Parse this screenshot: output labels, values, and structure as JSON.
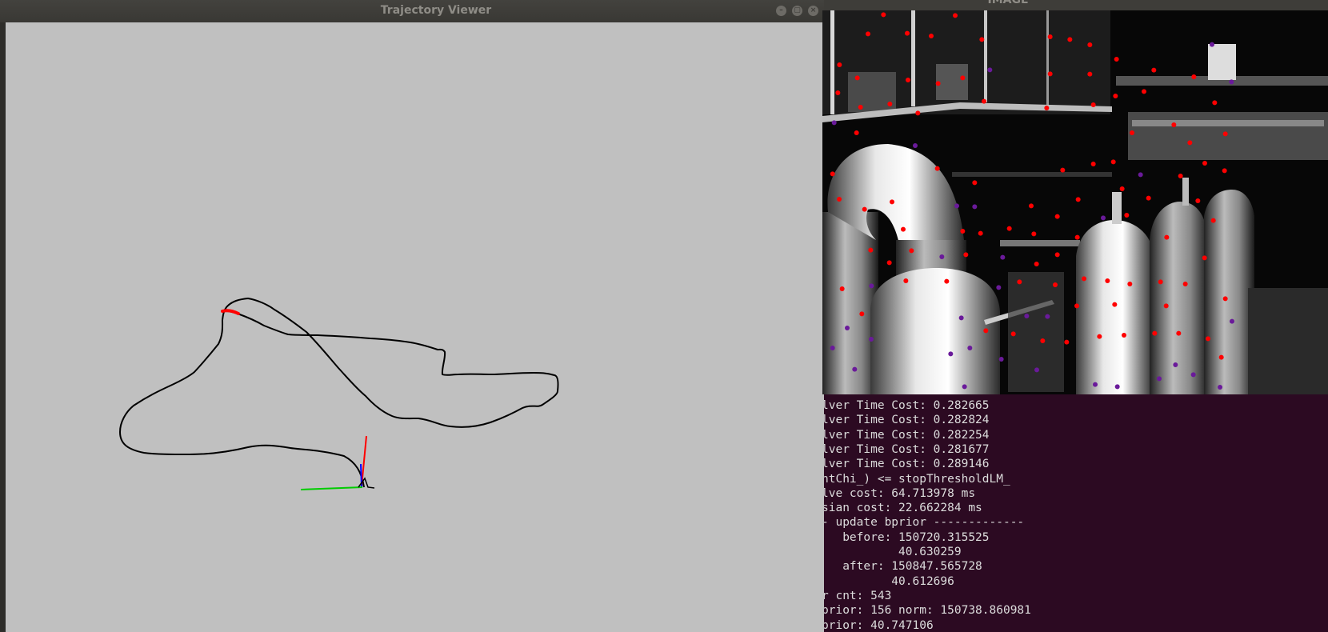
{
  "trajectory_window": {
    "title": "Trajectory Viewer",
    "controls": [
      {
        "name": "minimize",
        "glyph": "–"
      },
      {
        "name": "maximize",
        "glyph": "▢"
      },
      {
        "name": "close",
        "glyph": "×"
      }
    ],
    "background_color": "#c0c0c0",
    "path_color": "#000000",
    "current_segment_color": "#ff0000",
    "axis_colors": {
      "x": "#ff0000",
      "y": "#00cc00",
      "z": "#0000ff"
    }
  },
  "image_window": {
    "title": "IMAGE",
    "feature_colors": {
      "tracked": "#ff0000",
      "new": "#6a1a9a"
    }
  },
  "terminal": {
    "background_color": "#2c0a22",
    "lines": [
      "lver Time Cost: 0.282665",
      "lver Time Cost: 0.282824",
      "lver Time Cost: 0.282254",
      "lver Time Cost: 0.281677",
      "lver Time Cost: 0.289146",
      "ntChi_) <= stopThresholdLM_",
      "lve cost: 64.713978 ms",
      "sian cost: 22.662284 ms",
      "- update bprior -------------",
      "   before: 150720.315525",
      "           40.630259",
      "   after: 150847.565728",
      "          40.612696",
      "r cnt: 543",
      "prior: 156 norm: 150738.860981",
      "prior: 40.747106"
    ]
  }
}
